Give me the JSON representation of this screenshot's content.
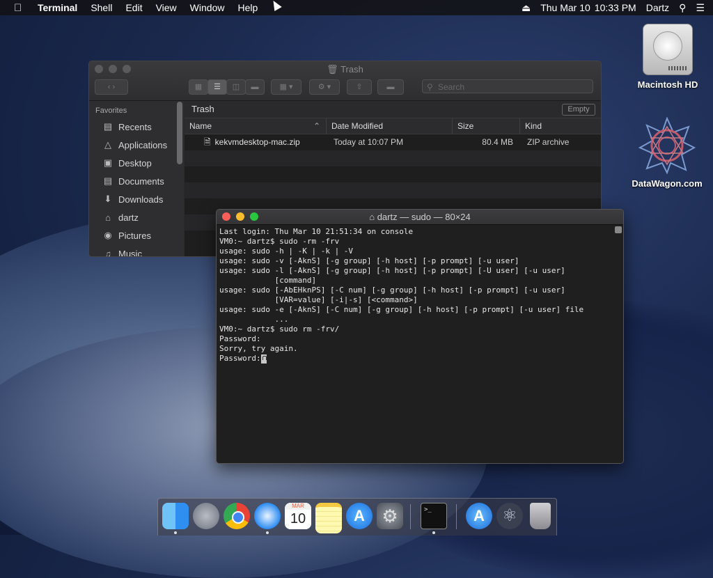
{
  "menubar": {
    "app": "Terminal",
    "items": [
      "Shell",
      "Edit",
      "View",
      "Window",
      "Help"
    ],
    "date": "Thu Mar 10",
    "time": "10:33 PM",
    "user": "Dartz"
  },
  "desktop": {
    "icons": [
      {
        "label": "Macintosh HD"
      },
      {
        "label": "DataWagon.com"
      }
    ]
  },
  "finder": {
    "title": "Trash",
    "search_placeholder": "Search",
    "sidebar_header": "Favorites",
    "sidebar_items": [
      {
        "label": "Recents",
        "icon": "clock-icon"
      },
      {
        "label": "Applications",
        "icon": "applications-icon"
      },
      {
        "label": "Desktop",
        "icon": "desktop-icon"
      },
      {
        "label": "Documents",
        "icon": "documents-icon"
      },
      {
        "label": "Downloads",
        "icon": "downloads-icon"
      },
      {
        "label": "dartz",
        "icon": "home-icon"
      },
      {
        "label": "Pictures",
        "icon": "camera-icon"
      },
      {
        "label": "Music",
        "icon": "music-icon"
      }
    ],
    "path_label": "Trash",
    "empty_label": "Empty",
    "columns": [
      "Name",
      "Date Modified",
      "Size",
      "Kind"
    ],
    "files": [
      {
        "name": "kekvmdesktop-mac.zip",
        "modified": "Today at 10:07 PM",
        "size": "80.4 MB",
        "kind": "ZIP archive"
      }
    ]
  },
  "terminal": {
    "title": "dartz — sudo — 80×24",
    "lines": [
      "Last login: Thu Mar 10 21:51:34 on console",
      "VM0:~ dartz$ sudo -rm -frv",
      "usage: sudo -h | -K | -k | -V",
      "usage: sudo -v [-AknS] [-g group] [-h host] [-p prompt] [-u user]",
      "usage: sudo -l [-AknS] [-g group] [-h host] [-p prompt] [-U user] [-u user]",
      "            [command]",
      "usage: sudo [-AbEHknPS] [-C num] [-g group] [-h host] [-p prompt] [-u user]",
      "            [VAR=value] [-i|-s] [<command>]",
      "usage: sudo -e [-AknS] [-C num] [-g group] [-h host] [-p prompt] [-u user] file",
      "            ...",
      "VM0:~ dartz$ sudo rm -frv/",
      "Password:",
      "Sorry, try again."
    ],
    "prompt": "Password:"
  },
  "dock": {
    "items": [
      "Finder",
      "Launchpad",
      "Chrome",
      "Safari",
      "Calendar",
      "Notes",
      "App Store",
      "System Preferences",
      "Terminal",
      "Applications",
      "Atom",
      "Trash"
    ],
    "calendar_month": "MAR",
    "calendar_day": "10"
  }
}
